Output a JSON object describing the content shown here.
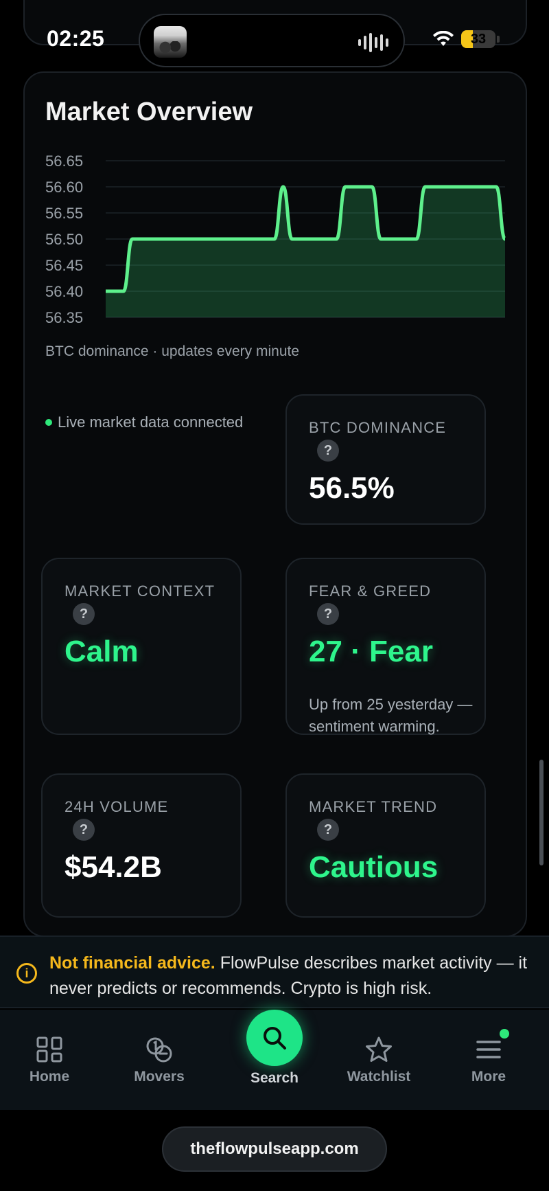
{
  "status_bar": {
    "time": "02:25",
    "battery": "33",
    "battery_level": 0.33
  },
  "card": {
    "title": "Market Overview"
  },
  "chart_data": {
    "type": "area",
    "x": [
      0,
      1,
      2,
      3,
      4,
      5,
      6,
      7,
      8,
      9,
      10,
      11,
      12,
      13,
      14,
      15,
      16,
      17,
      18,
      19,
      20,
      21,
      22,
      23,
      24,
      25,
      26,
      27,
      28,
      29,
      30,
      31,
      32,
      33,
      34,
      35,
      36,
      37,
      38,
      39,
      40,
      41,
      42,
      43,
      44,
      45
    ],
    "values": [
      56.4,
      56.4,
      56.4,
      56.5,
      56.5,
      56.5,
      56.5,
      56.5,
      56.5,
      56.5,
      56.5,
      56.5,
      56.5,
      56.5,
      56.5,
      56.5,
      56.5,
      56.5,
      56.5,
      56.5,
      56.6,
      56.5,
      56.5,
      56.5,
      56.5,
      56.5,
      56.5,
      56.6,
      56.6,
      56.6,
      56.6,
      56.5,
      56.5,
      56.5,
      56.5,
      56.5,
      56.6,
      56.6,
      56.6,
      56.6,
      56.6,
      56.6,
      56.6,
      56.6,
      56.6,
      56.5
    ],
    "ylim": [
      56.35,
      56.65
    ],
    "yticks": [
      "56.65",
      "56.60",
      "56.55",
      "56.50",
      "56.45",
      "56.40",
      "56.35"
    ],
    "grid": true,
    "color": "#5ef08c",
    "caption": "BTC dominance · updates every minute"
  },
  "live_status": "Live market data connected",
  "tiles": {
    "btc_dominance": {
      "label": "BTC DOMINANCE",
      "value": "56.5%"
    },
    "market_context": {
      "label": "MARKET CONTEXT",
      "value": "Calm"
    },
    "fear_greed": {
      "label": "FEAR & GREED",
      "value": "27 · Fear",
      "note": "Up from 25 yesterday — sentiment warming."
    },
    "volume": {
      "label": "24H VOLUME",
      "value": "$54.2B"
    },
    "trend": {
      "label": "MARKET TREND",
      "value": "Cautious"
    },
    "help_glyph": "?"
  },
  "disclaimer": {
    "strong": "Not financial advice.",
    "text": " FlowPulse describes market activity — it never predicts or recommends. Crypto is high risk.",
    "icon": "info-icon"
  },
  "nav": {
    "home": "Home",
    "movers": "Movers",
    "search": "Search",
    "watchlist": "Watchlist",
    "more": "More"
  },
  "url": "theflowpulseapp.com",
  "colors": {
    "accent": "#1ee487",
    "warning": "#f5b81c",
    "background": "#000000"
  }
}
